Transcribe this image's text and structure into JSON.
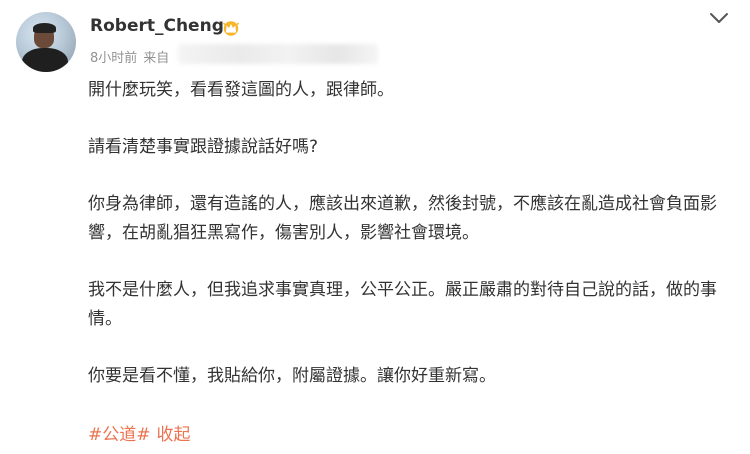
{
  "post": {
    "author": "Robert_Cheng",
    "time": "8小时前",
    "source_label": "来自",
    "paragraphs": [
      "開什麼玩笑，看看發這圖的人，跟律師。",
      "請看清楚事實跟證據說話好嗎?",
      "你身為律師，還有造謠的人，應該出來道歉，然後封號，不應該在亂造成社會負面影響，在胡亂猖狂黑寫作，傷害別人，影響社會環境。",
      "我不是什麼人，但我追求事實真理，公平公正。嚴正嚴肅的對待自己說的話，做的事情。",
      "你要是看不懂，我貼給你，附屬證據。讓你好重新寫。"
    ],
    "hashtag": "#公道#",
    "collapse_label": "收起"
  },
  "colors": {
    "accent": "#eb7350",
    "text": "#333333",
    "meta": "#939393"
  },
  "icons": {
    "verified": "crown-icon",
    "menu": "chevron-down-icon"
  }
}
